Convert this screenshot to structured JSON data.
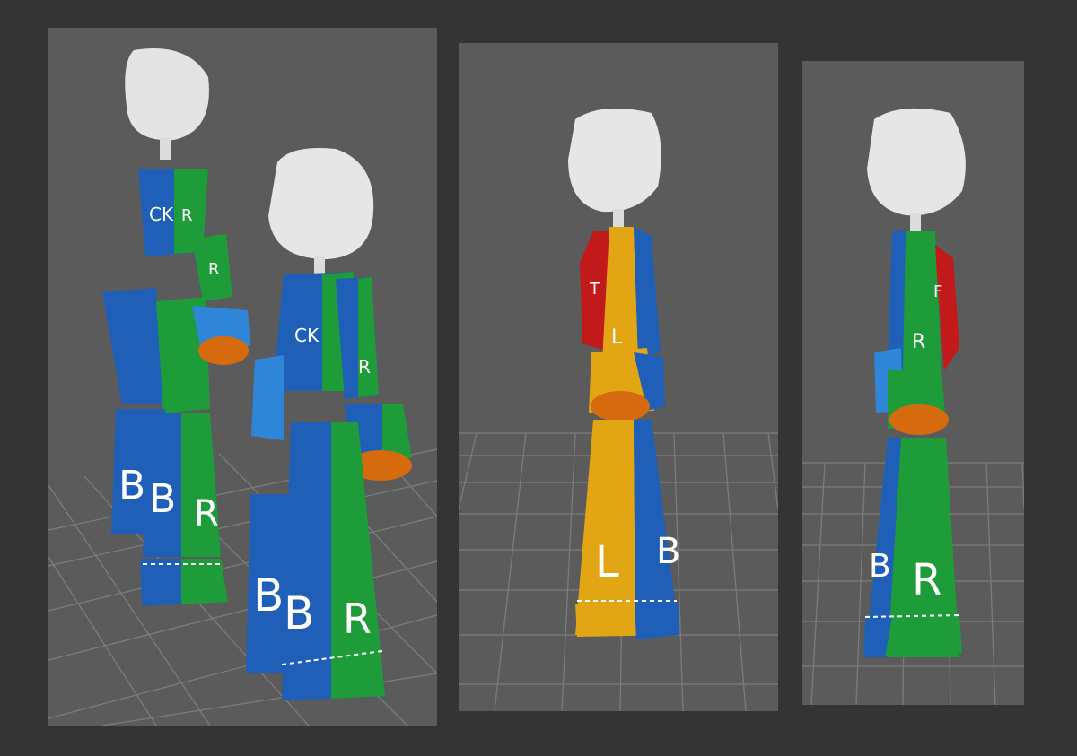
{
  "viewports": [
    {
      "name": "perspective-left",
      "figures": [
        {
          "name": "character-rear",
          "labels": {
            "back": "CK",
            "right_arm": "R",
            "right_arm_upper": "R",
            "left_leg": "B",
            "right_leg": "R",
            "left_thigh": "B"
          }
        },
        {
          "name": "character-front",
          "labels": {
            "back": "CK",
            "right_arm": "R",
            "left_leg": "B",
            "right_leg": "R",
            "left_leg2": "B"
          }
        }
      ]
    },
    {
      "name": "perspective-middle",
      "figures": [
        {
          "name": "character-side-left",
          "labels": {
            "torso": "L",
            "leg": "L",
            "edge": "B",
            "shoulder": "T"
          }
        }
      ]
    },
    {
      "name": "perspective-right",
      "figures": [
        {
          "name": "character-side-right",
          "labels": {
            "torso": "R",
            "leg": "R",
            "edge": "B",
            "shoulder": "F"
          }
        }
      ]
    }
  ],
  "colors": {
    "background": "#343434",
    "viewport": "#5b5b5b",
    "grid": "#7a7a7a",
    "blue": "#1f5fb8",
    "blue_light": "#2f86d8",
    "green": "#1f9c3a",
    "red": "#c21a1a",
    "yellow": "#e2a514",
    "orange": "#d66a0e",
    "head": "#e6e6e6"
  }
}
